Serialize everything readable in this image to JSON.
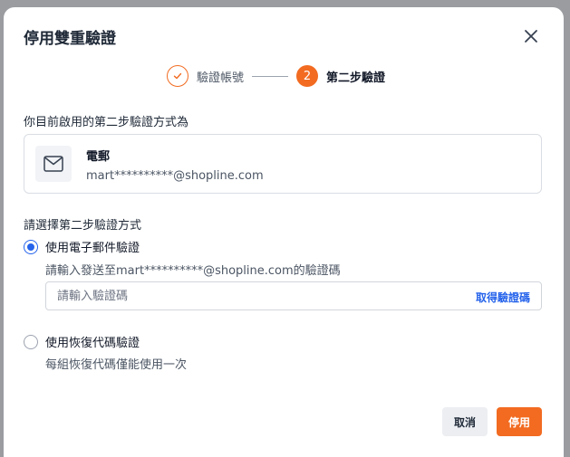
{
  "dialog": {
    "title": "停用雙重驗證"
  },
  "stepper": {
    "steps": [
      {
        "index": "1",
        "label": "驗證帳號",
        "status": "done"
      },
      {
        "index": "2",
        "label": "第二步驗證",
        "status": "active"
      }
    ]
  },
  "current_method": {
    "section_label": "你目前啟用的第二步驗證方式為",
    "name": "電郵",
    "value": "mart**********@shopline.com",
    "icon": "envelope-icon"
  },
  "choose": {
    "section_label": "請選擇第二步驗證方式",
    "options": [
      {
        "label": "使用電子郵件驗證",
        "description": "請輸入發送至mart**********@shopline.com的驗證碼",
        "selected": true
      },
      {
        "label": "使用恢復代碼驗證",
        "description": "每組恢復代碼僅能使用一次",
        "selected": false
      }
    ],
    "code_input": {
      "placeholder": "請輸入驗證碼",
      "value": ""
    },
    "get_code_label": "取得驗證碼"
  },
  "footer": {
    "cancel_label": "取消",
    "disable_label": "停用"
  },
  "colors": {
    "accent": "#f26b21",
    "link": "#2563eb"
  }
}
